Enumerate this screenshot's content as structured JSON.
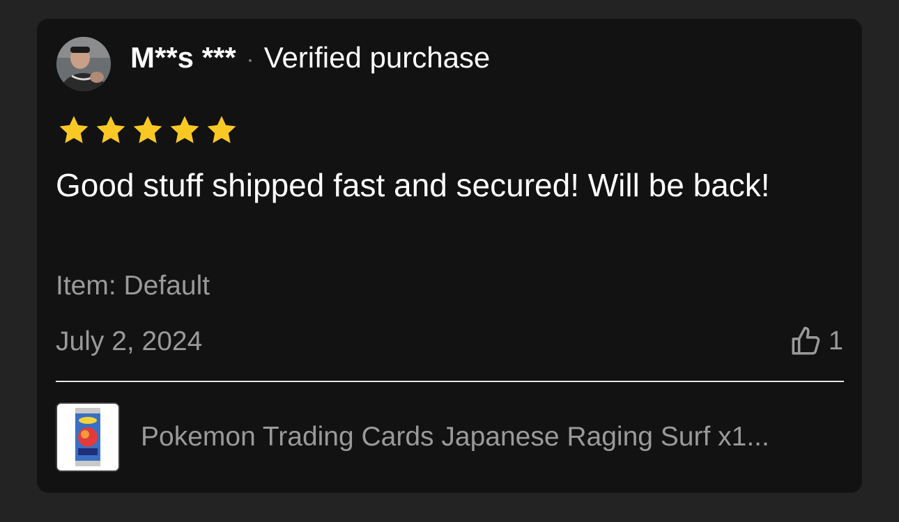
{
  "review": {
    "reviewer_name": "M**s ***",
    "verified_label": "Verified purchase",
    "rating": 5,
    "rating_max": 5,
    "body": "Good stuff shipped fast and secured! Will be back!",
    "item_label": "Item: Default",
    "date": "July 2, 2024",
    "like_count": "1"
  },
  "product": {
    "title": "Pokemon Trading Cards Japanese Raging Surf x1..."
  },
  "colors": {
    "background": "#232323",
    "card": "#121212",
    "star": "#f9c824",
    "muted_text": "#9a9a9a"
  },
  "icons": {
    "avatar": "reviewer-avatar",
    "star": "star-icon",
    "like": "thumbs-up-icon",
    "product": "product-thumbnail"
  }
}
